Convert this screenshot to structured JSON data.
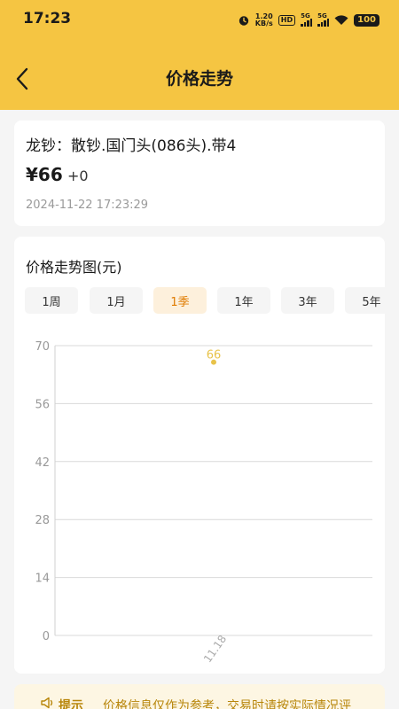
{
  "status_bar": {
    "time": "17:23",
    "net_speed_value": "1.20",
    "net_speed_unit": "KB/s",
    "hd_label": "HD",
    "sig1_label": "5G",
    "sig2_label": "5G",
    "battery": "100"
  },
  "header": {
    "title": "价格走势"
  },
  "product": {
    "name": "龙钞：散钞.国门头(086头).带4",
    "price": "¥66",
    "change": "+0",
    "timestamp": "2024-11-22 17:23:29"
  },
  "chart_section": {
    "title": "价格走势图(元)",
    "tabs": [
      {
        "label": "1周",
        "active": false
      },
      {
        "label": "1月",
        "active": false
      },
      {
        "label": "1季",
        "active": true
      },
      {
        "label": "1年",
        "active": false
      },
      {
        "label": "3年",
        "active": false
      },
      {
        "label": "5年",
        "active": false
      }
    ]
  },
  "chart_data": {
    "type": "scatter",
    "x": [
      "11.18"
    ],
    "y": [
      66
    ],
    "data_labels": [
      "66"
    ],
    "xlabel": "",
    "ylabel": "",
    "ylim": [
      0,
      70
    ],
    "yticks": [
      0,
      14,
      28,
      42,
      56,
      70
    ],
    "grid": true,
    "point_color": "#e8c34a"
  },
  "notice": {
    "label": "提示",
    "text": "价格信息仅作为参考，交易时请按实际情况评"
  },
  "colors": {
    "accent": "#f5c542",
    "active_tab_bg": "#fdf0dc",
    "active_tab_text": "#e07b00"
  }
}
